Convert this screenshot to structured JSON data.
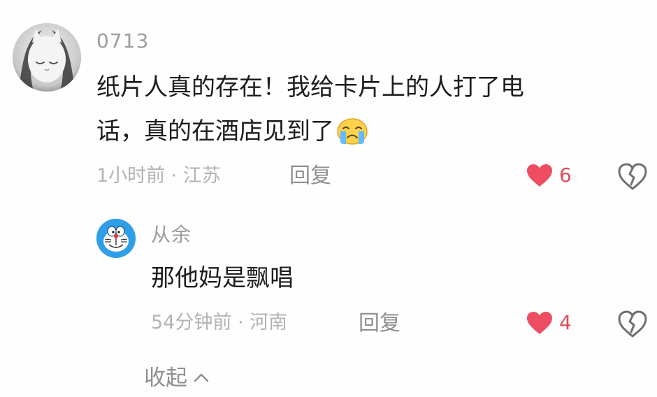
{
  "comments": {
    "main": {
      "username": "0713",
      "line1": "纸片人真的存在！我给卡片上的人打了电",
      "line2": "话，真的在酒店见到了",
      "meta": "1小时前 · 江苏",
      "reply_label": "回复",
      "like_count": "6"
    },
    "reply": {
      "username": "从余",
      "text": "那他妈是飘唱",
      "meta": "54分钟前 · 河南",
      "reply_label": "回复",
      "like_count": "4"
    }
  },
  "collapse_label": "收起",
  "icons": {
    "inline_emoji": "crying-face-icon",
    "like": "heart-icon",
    "dislike": "broken-heart-icon",
    "collapse": "chevron-up-icon"
  },
  "colors": {
    "heart": "#ef4d62",
    "username": "#9d9d9d",
    "text": "#1d1d1d"
  }
}
